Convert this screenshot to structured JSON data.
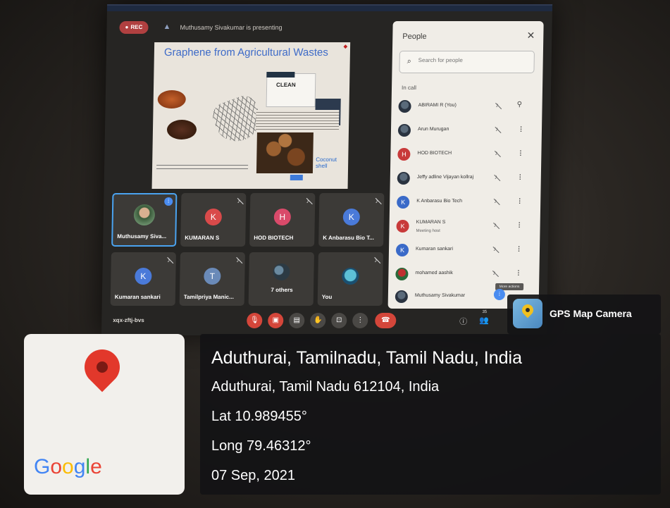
{
  "meet": {
    "rec_label": "REC",
    "presenter_text": "Muthusamy Sivakumar is presenting",
    "meeting_code": "xqx-zftj-bvs",
    "slide": {
      "title": "Graphene from Agricultural Wastes",
      "header_text": "CLEAN",
      "caption": "Coconut shell"
    },
    "tiles": [
      {
        "name": "Muthusamy Siva...",
        "avatar": "photo"
      },
      {
        "name": "KUMARAN S",
        "initial": "K",
        "color": "#d94a4a"
      },
      {
        "name": "HOD BIOTECH",
        "initial": "H",
        "color": "#d94a6a"
      },
      {
        "name": "K Anbarasu Bio T...",
        "initial": "K",
        "color": "#4a7ad9"
      },
      {
        "name": "Kumaran sankari",
        "initial": "K",
        "color": "#4a7ad9"
      },
      {
        "name": "Tamilpriya Manic...",
        "initial": "T",
        "color": "#6a8ab8"
      },
      {
        "name": "7 others",
        "avatar": "group"
      },
      {
        "name": "You",
        "avatar": "you"
      }
    ],
    "controls": {
      "mic_icon": "mic-off-icon",
      "camera_icon": "camera-off-icon",
      "captions_icon": "captions-icon",
      "hand_icon": "raise-hand-icon",
      "present_icon": "present-icon",
      "more_icon": "more-vert-icon",
      "end_icon": "call-end-icon",
      "participant_count": "35"
    },
    "people_panel": {
      "title": "People",
      "search_placeholder": "Search for people",
      "section_label": "In call",
      "people": [
        {
          "name": "ABIRAMI R (You)",
          "avatar": "img"
        },
        {
          "name": "Arun Murugan",
          "avatar": "img"
        },
        {
          "name": "HOD BIOTECH",
          "initial": "H",
          "color": "#c83a3a"
        },
        {
          "name": "Jeffy adline Vijayan kollraj",
          "avatar": "img"
        },
        {
          "name": "K Anbarasu Bio Tech",
          "initial": "K",
          "color": "#3a6ac8"
        },
        {
          "name": "KUMARAN S",
          "sub": "Meeting host",
          "initial": "K",
          "color": "#c83a3a"
        },
        {
          "name": "Kumaran sankari",
          "initial": "K",
          "color": "#3a6ac8"
        },
        {
          "name": "mohamed aashik",
          "avatar": "img"
        },
        {
          "name": "Muthusamy Sivakumar",
          "avatar": "img"
        }
      ],
      "tooltip": "More actions"
    }
  },
  "gps": {
    "app_name": "GPS Map Camera",
    "address_line1": "Aduthurai, Tamilnadu, Tamil Nadu, India",
    "address_line2": "Aduthurai, Tamil Nadu 612104, India",
    "latitude": "Lat 10.989455°",
    "longitude": "Long 79.46312°",
    "date": "07 Sep, 2021",
    "map_logo": "Google"
  },
  "colors": {
    "meet_red": "#d4463a",
    "meet_blue": "#4a8cf0",
    "pin_red": "#e2382b"
  }
}
